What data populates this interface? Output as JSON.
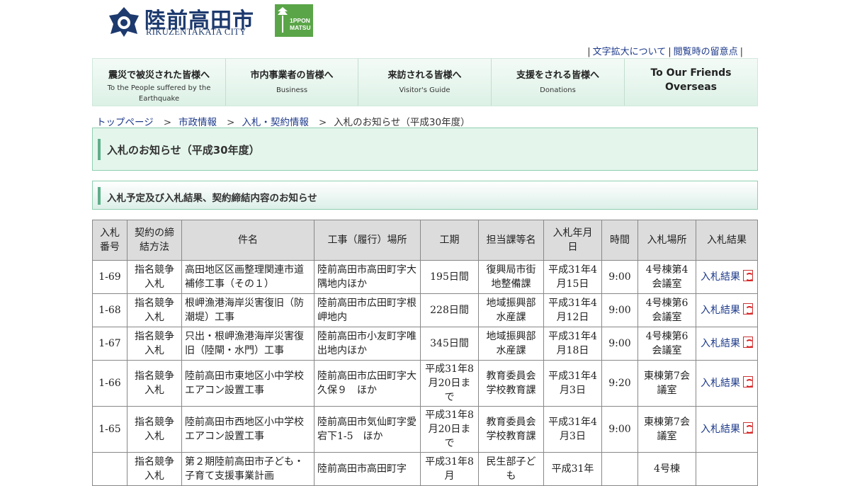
{
  "header": {
    "logo_title": "陸前高田市",
    "logo_roman": "RIKUZENTAKATA CITY",
    "badge_line1": "1PPON",
    "badge_line2": "MATSU",
    "colors": {
      "brand_navy": "#1d3a6e",
      "badge_green": "#5aa548",
      "link": "#1d3a8a"
    }
  },
  "util_links": [
    "文字拡大について",
    "閲覧時の留意点"
  ],
  "nav": [
    {
      "title": "震災で被災された皆様へ",
      "sub": "To the People suffered by the Earthquake"
    },
    {
      "title": "市内事業者の皆様へ",
      "sub": "Business"
    },
    {
      "title": "来訪される皆様へ",
      "sub": "Visitor's Guide"
    },
    {
      "title": "支援をされる皆様へ",
      "sub": "Donations"
    },
    {
      "title": "To Our Friends Overseas",
      "sub": ""
    }
  ],
  "breadcrumb": {
    "items": [
      "トップページ",
      "市政情報",
      "入札・契約情報"
    ],
    "current": "入札のお知らせ（平成30年度）",
    "separator": ">"
  },
  "page_title": "入札のお知らせ（平成30年度）",
  "section_title": "入札予定及び入札結果、契約締結内容のお知らせ",
  "table": {
    "headers": [
      "入札番号",
      "契約の締結方法",
      "件名",
      "工事（履行）場所",
      "工期",
      "担当課等名",
      "入札年月日",
      "時間",
      "入札場所",
      "入札結果"
    ],
    "rows": [
      {
        "no": "1-69",
        "method": "指名競争入札",
        "name": "高田地区区画整理関連市道補修工事（その１）",
        "place": "陸前高田市高田町字大隅地内ほか",
        "period": "195日間",
        "dept": "復興局市街地整備課",
        "date": "平成31年4月15日",
        "time": "9:00",
        "venue": "4号棟第4会議室",
        "result": "入札結果"
      },
      {
        "no": "1-68",
        "method": "指名競争入札",
        "name": "根岬漁港海岸災害復旧（防潮堤）工事",
        "place": "陸前高田市広田町字根岬地内",
        "period": "228日間",
        "dept": "地域振興部水産課",
        "date": "平成31年4月12日",
        "time": "9:00",
        "venue": "4号棟第6会議室",
        "result": "入札結果"
      },
      {
        "no": "1-67",
        "method": "指名競争入札",
        "name": "只出・根岬漁港海岸災害復旧（陸閘・水門）工事",
        "place": "陸前高田市小友町字唯出地内ほか",
        "period": "345日間",
        "dept": "地域振興部水産課",
        "date": "平成31年4月18日",
        "time": "9:00",
        "venue": "4号棟第6会議室",
        "result": "入札結果"
      },
      {
        "no": "1-66",
        "method": "指名競争入札",
        "name": "陸前高田市東地区小中学校エアコン設置工事",
        "place": "陸前高田市広田町字大久保９　ほか",
        "period": "平成31年8月20日まで",
        "dept": "教育委員会学校教育課",
        "date": "平成31年4月3日",
        "time": "9:20",
        "venue": "東棟第7会議室",
        "result": "入札結果"
      },
      {
        "no": "1-65",
        "method": "指名競争入札",
        "name": "陸前高田市西地区小中学校エアコン設置工事",
        "place": "陸前高田市気仙町字愛宕下1-5　ほか",
        "period": "平成31年8月20日まで",
        "dept": "教育委員会学校教育課",
        "date": "平成31年4月3日",
        "time": "9:00",
        "venue": "東棟第7会議室",
        "result": "入札結果"
      },
      {
        "no": "",
        "method": "指名競争入札",
        "name": "第２期陸前高田市子ども・子育て支援事業計画",
        "place": "陸前高田市高田町字",
        "period": "平成31年8月",
        "dept": "民生部子ども",
        "date": "平成31年",
        "time": "",
        "venue": "4号棟",
        "result": ""
      }
    ]
  }
}
